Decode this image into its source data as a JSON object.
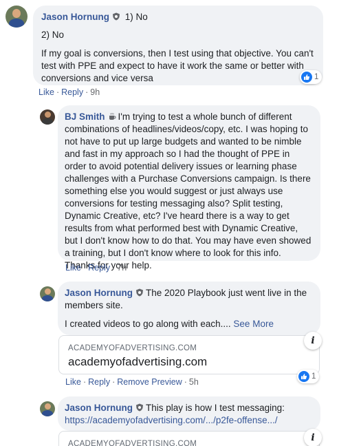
{
  "comments": [
    {
      "author": "Jason Hornung",
      "badge_icon": "shield-badge-icon",
      "lines": [
        "1) No",
        "2) No",
        "If my goal is conversions, then I test using that objective. You can't test with PPE and expect to have it work the same or better with conversions and vice versa"
      ],
      "actions": {
        "like": "Like",
        "reply": "Reply",
        "time": "9h"
      },
      "reaction_count": "1"
    },
    {
      "author": "BJ Smith",
      "badge_icon": "coffee-cup-icon",
      "text": "I'm trying to test a whole bunch of different combinations of headlines/videos/copy, etc. I was hoping to not have to put up large budgets and wanted to be nimble and fast in my approach so I had the thought of PPE in order to avoid potential delivery issues or learning phase challenges with a Purchase Conversions campaign. Is there something else you would suggest or just always use conversions for testing messaging also? Split testing, Dynamic Creative, etc? I've heard there is a way to get results from what performed best with Dynamic Creative, but I don't know how to do that. You may have even showed a training, but I don't know where to look for this info. Thanks for your help.",
      "actions": {
        "like": "Like",
        "reply": "Reply",
        "time": "7h"
      }
    },
    {
      "author": "Jason Hornung",
      "badge_icon": "shield-badge-icon",
      "text": "The 2020 Playbook just went live in the members site.",
      "text2": "I created videos to go along with each....",
      "see_more": "See More",
      "preview": {
        "domain": "ACADEMYOFADVERTISING.COM",
        "title": "academyofadvertising.com"
      },
      "actions": {
        "like": "Like",
        "reply": "Reply",
        "remove_preview": "Remove Preview",
        "time": "5h"
      },
      "reaction_count": "1"
    },
    {
      "author": "Jason Hornung",
      "badge_icon": "shield-badge-icon",
      "text": "This play is how I test messaging:",
      "link": "https://academyofadvertising.com/.../p2fe-offense.../",
      "preview": {
        "domain": "ACADEMYOFADVERTISING.COM"
      }
    }
  ],
  "colors": {
    "link": "#385898",
    "bubble": "#f0f2f5",
    "like": "#1877f2"
  }
}
